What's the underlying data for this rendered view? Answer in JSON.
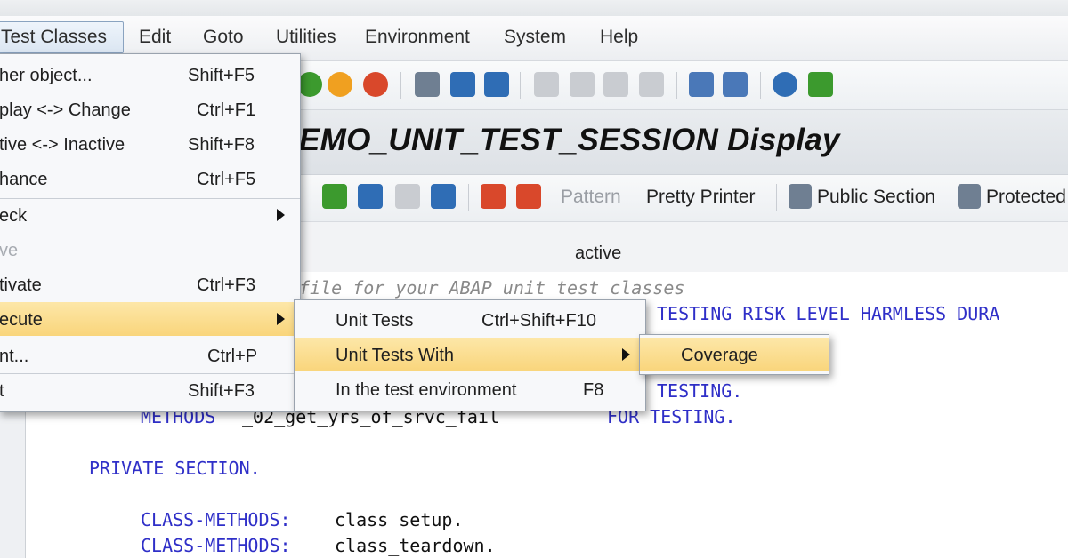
{
  "menubar": {
    "items": [
      "Test Classes",
      "Edit",
      "Goto",
      "Utilities",
      "Environment",
      "System",
      "Help"
    ]
  },
  "toolbar": {
    "icons": [
      "exit-icon",
      "favorites-icon",
      "cancel-icon",
      "print-icon",
      "find-icon",
      "find-next-icon",
      "first-page-icon",
      "previous-page-icon",
      "next-page-icon",
      "last-page-icon",
      "create-session-icon",
      "shortcut-icon",
      "help-icon",
      "customize-layout-icon"
    ],
    "colors": {
      "green": "#3c9a2e",
      "orange": "#f0a020",
      "red": "#d9482b",
      "blue": "#2f6db5"
    }
  },
  "title": "EMO_UNIT_TEST_SESSION Display",
  "app_toolbar": {
    "pattern": "Pattern",
    "pretty_printer": "Pretty Printer",
    "public_section": "Public Section",
    "protected": "Protected"
  },
  "status": "active",
  "code": {
    "comment": "file for your ABAP unit test classes",
    "line1": "TESTING RISK LEVEL HARMLESS DURA",
    "line2": "TESTING.",
    "line3_methods": "METHODS",
    "line3_name": "_02_get_yrs_of_srvc_fail",
    "line3_for": "FOR TESTING.",
    "private": "PRIVATE SECTION.",
    "cm_kw": "CLASS-METHODS:",
    "setup": "class_setup.",
    "teardown": "class_teardown."
  },
  "menu_main": {
    "items": [
      {
        "label": "her object...",
        "shortcut": "Shift+F5"
      },
      {
        "label": "play <-> Change",
        "shortcut": "Ctrl+F1"
      },
      {
        "label": "tive <-> Inactive",
        "shortcut": "Shift+F8"
      },
      {
        "label": "hance",
        "shortcut": "Ctrl+F5"
      },
      {
        "label": "eck",
        "shortcut": ""
      },
      {
        "label": "ve",
        "shortcut": ""
      },
      {
        "label": "tivate",
        "shortcut": "Ctrl+F3"
      },
      {
        "label": "ecute",
        "shortcut": ""
      },
      {
        "label": "nt...",
        "shortcut": "Ctrl+P"
      },
      {
        "label": "t",
        "shortcut": "Shift+F3"
      }
    ]
  },
  "menu_execute": {
    "items": [
      {
        "label": "Unit Tests",
        "shortcut": "Ctrl+Shift+F10"
      },
      {
        "label": "Unit Tests With",
        "shortcut": ""
      },
      {
        "label": "In the test environment",
        "shortcut": "F8"
      }
    ]
  },
  "menu_with": {
    "items": [
      {
        "label": "Coverage"
      }
    ]
  }
}
